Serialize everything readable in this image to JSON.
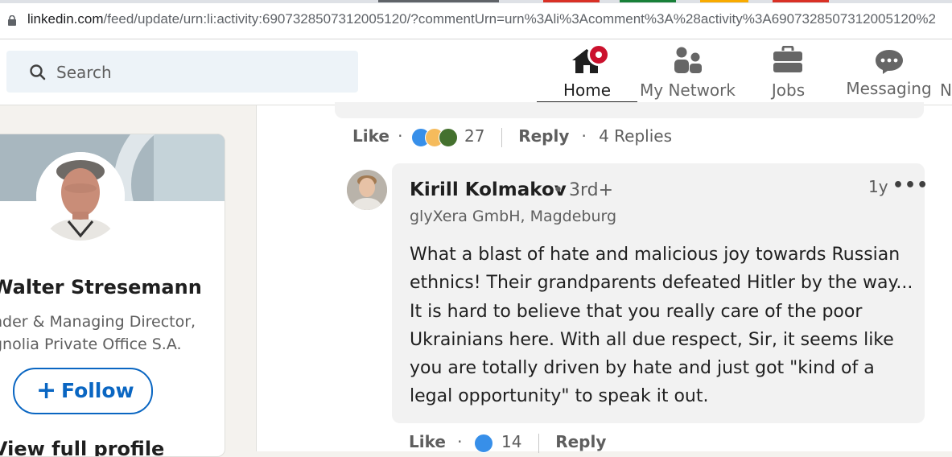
{
  "browser": {
    "url_host": "linkedin.com",
    "url_path": "/feed/update/urn:li:activity:6907328507312005120/?commentUrn=urn%3Ali%3Acomment%3A%28activity%3A6907328507312005120%2"
  },
  "header": {
    "search_placeholder": "Search",
    "nav": [
      {
        "label": "Home",
        "active": true,
        "icon": "home-icon",
        "has_badge": true
      },
      {
        "label": "My Network",
        "icon": "people-icon"
      },
      {
        "label": "Jobs",
        "icon": "briefcase-icon"
      },
      {
        "label": "Messaging",
        "icon": "chat-bubble-icon"
      },
      {
        "label": "N"
      }
    ]
  },
  "profile": {
    "name": "Walter Stresemann",
    "headline_1": "nder & Managing Director,",
    "headline_2": "gnolia Private Office S.A.",
    "follow_label": "Follow",
    "view_full": "View full profile"
  },
  "prev_comment": {
    "like_label": "Like",
    "reaction_count": "27",
    "reply_label": "Reply",
    "replies_label": "4 Replies",
    "reactions": [
      "like-icon",
      "insightful-icon",
      "support-icon"
    ]
  },
  "comment": {
    "author": "Kirill Kolmakov",
    "degree": "• 3rd+",
    "subtitle": "glyXera GmbH, Magdeburg",
    "time": "1y",
    "menu": "•••",
    "body_lines": [
      "What a blast of hate and malicious joy towards Russian",
      "ethnics! Their grandparents defeated Hitler by the way...",
      "It is hard to believe that you really care of the poor",
      "Ukrainians here. With all due respect, Sir, it seems like",
      "you are totally driven by hate and just got \"kind of a",
      "legal opportunity\" to speak it out."
    ],
    "like_label": "Like",
    "reaction_count": "14",
    "reply_label": "Reply"
  },
  "colors": {
    "brand_blue": "#0a66c2",
    "notification_red": "#cb112d",
    "page_bg": "#f4f2ee",
    "comment_bg": "#f2f2f2"
  }
}
